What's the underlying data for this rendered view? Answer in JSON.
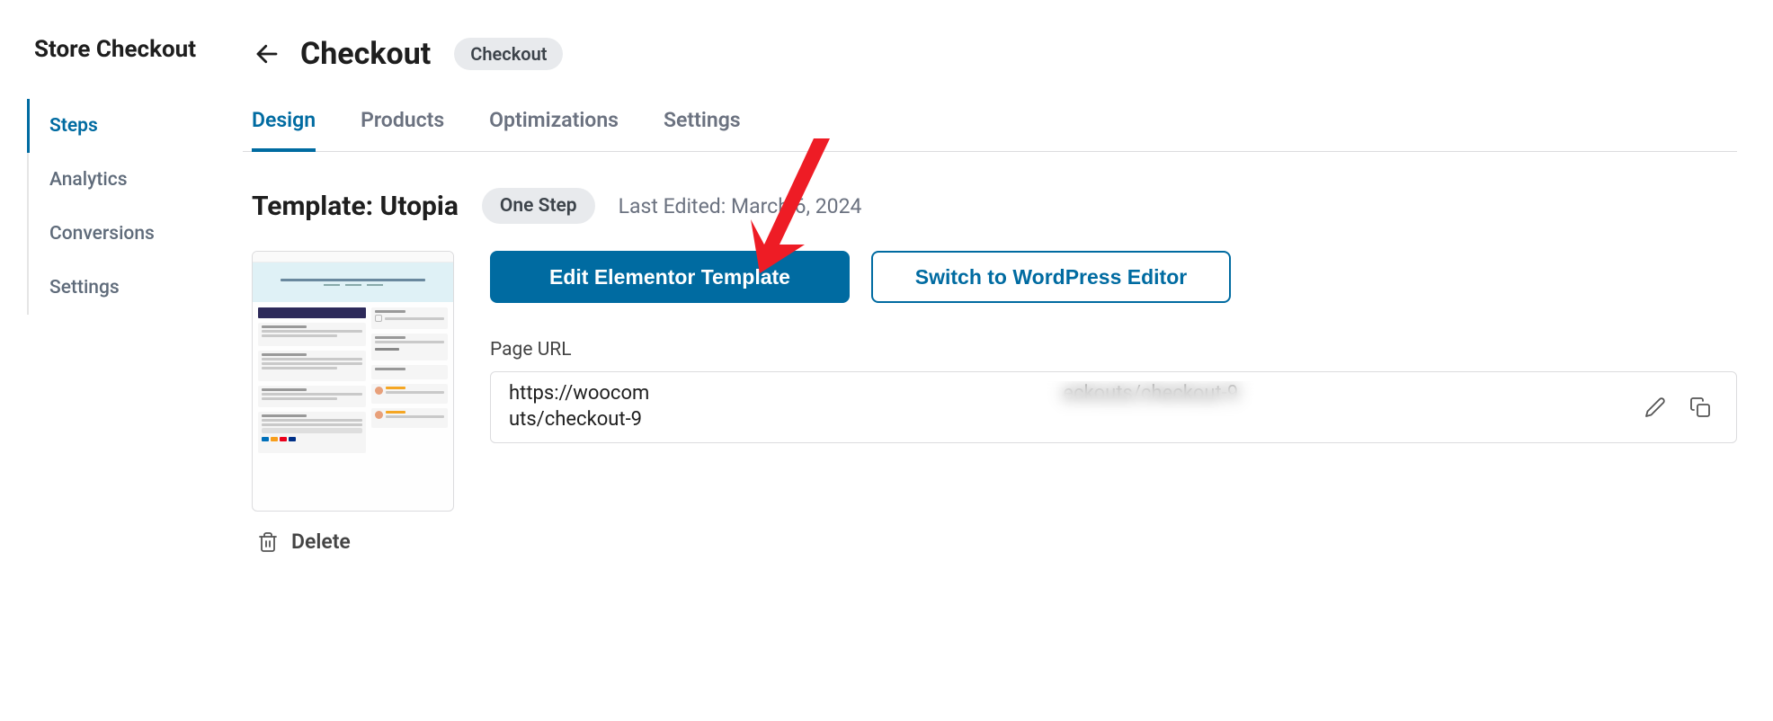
{
  "sidebar": {
    "title": "Store Checkout",
    "items": [
      {
        "label": "Steps",
        "active": true
      },
      {
        "label": "Analytics",
        "active": false
      },
      {
        "label": "Conversions",
        "active": false
      },
      {
        "label": "Settings",
        "active": false
      }
    ]
  },
  "header": {
    "title": "Checkout",
    "badge": "Checkout"
  },
  "tabs": [
    {
      "label": "Design",
      "active": true
    },
    {
      "label": "Products",
      "active": false
    },
    {
      "label": "Optimizations",
      "active": false
    },
    {
      "label": "Settings",
      "active": false
    }
  ],
  "template": {
    "label": "Template: Utopia",
    "pill": "One Step",
    "last_edited": "Last Edited: March 6, 2024"
  },
  "buttons": {
    "primary": "Edit Elementor Template",
    "secondary": "Switch to WordPress Editor"
  },
  "url_section": {
    "label": "Page URL",
    "line1": "https://woocom",
    "line1_end": "eckouts/checkout-9",
    "line2": "uts/checkout-9"
  },
  "delete": {
    "label": "Delete"
  }
}
